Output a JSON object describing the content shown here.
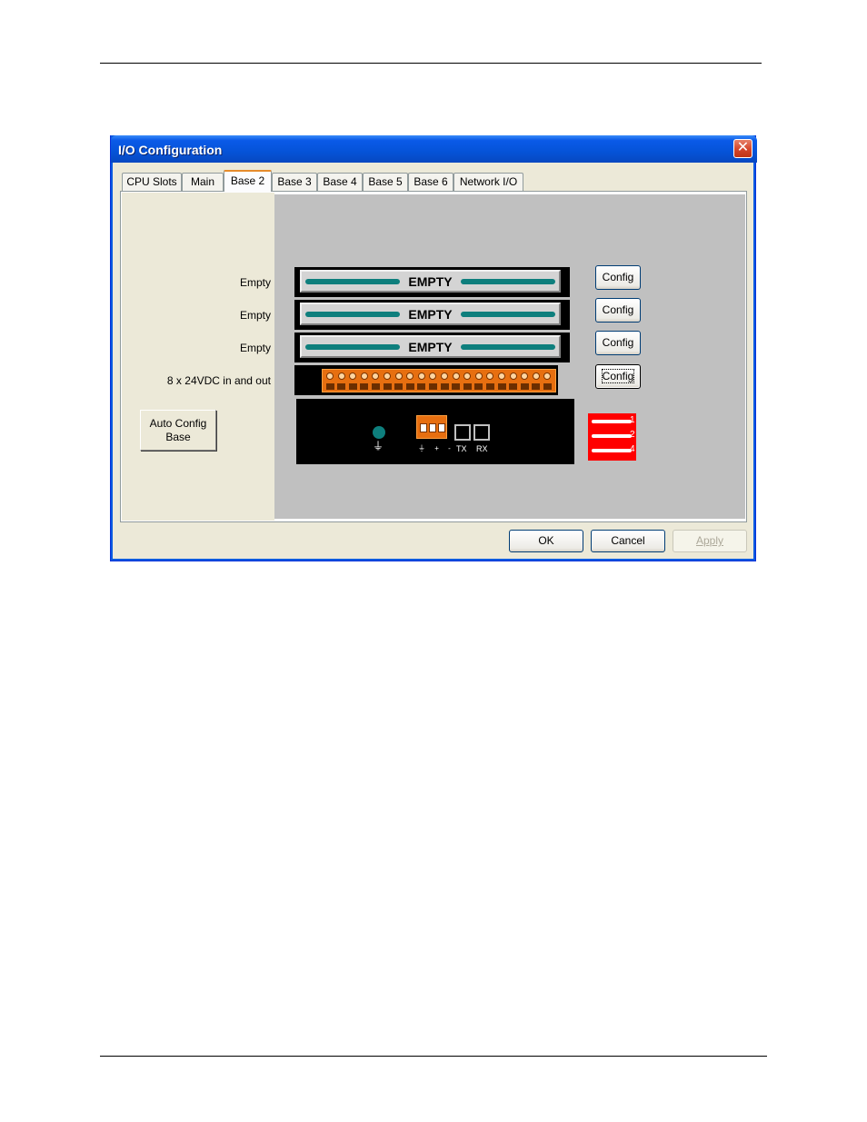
{
  "window": {
    "title": "I/O Configuration",
    "close_symbol": "✕"
  },
  "tabs": [
    {
      "label": "CPU Slots",
      "active": false
    },
    {
      "label": "Main",
      "active": false
    },
    {
      "label": "Base 2",
      "active": true
    },
    {
      "label": "Base 3",
      "active": false
    },
    {
      "label": "Base 4",
      "active": false
    },
    {
      "label": "Base 5",
      "active": false
    },
    {
      "label": "Base 6",
      "active": false
    },
    {
      "label": "Network I/O",
      "active": false
    }
  ],
  "slots": [
    {
      "label": "Empty",
      "module_text": "EMPTY",
      "button": "Config"
    },
    {
      "label": "Empty",
      "module_text": "EMPTY",
      "button": "Config"
    },
    {
      "label": "Empty",
      "module_text": "EMPTY",
      "button": "Config"
    },
    {
      "label": "8 x 24VDC in and out",
      "module_text": "",
      "button": "Config"
    }
  ],
  "base_module": {
    "ground_symbol": "⏚",
    "power_symbols": "⏚ + -",
    "tx_label": "TX",
    "rx_label": "RX",
    "dip_labels": [
      "1",
      "2",
      "4"
    ]
  },
  "auto_config": {
    "line1": "Auto Config",
    "line2": "Base"
  },
  "footer": {
    "ok": "OK",
    "cancel": "Cancel",
    "apply": "Apply"
  },
  "colors": {
    "titlebar": "#0553d8",
    "module_bar": "#0e7f7d",
    "io_terminal": "#e76f10",
    "dip_switch": "#ff0000",
    "panel_gray": "#c0c0c0"
  }
}
